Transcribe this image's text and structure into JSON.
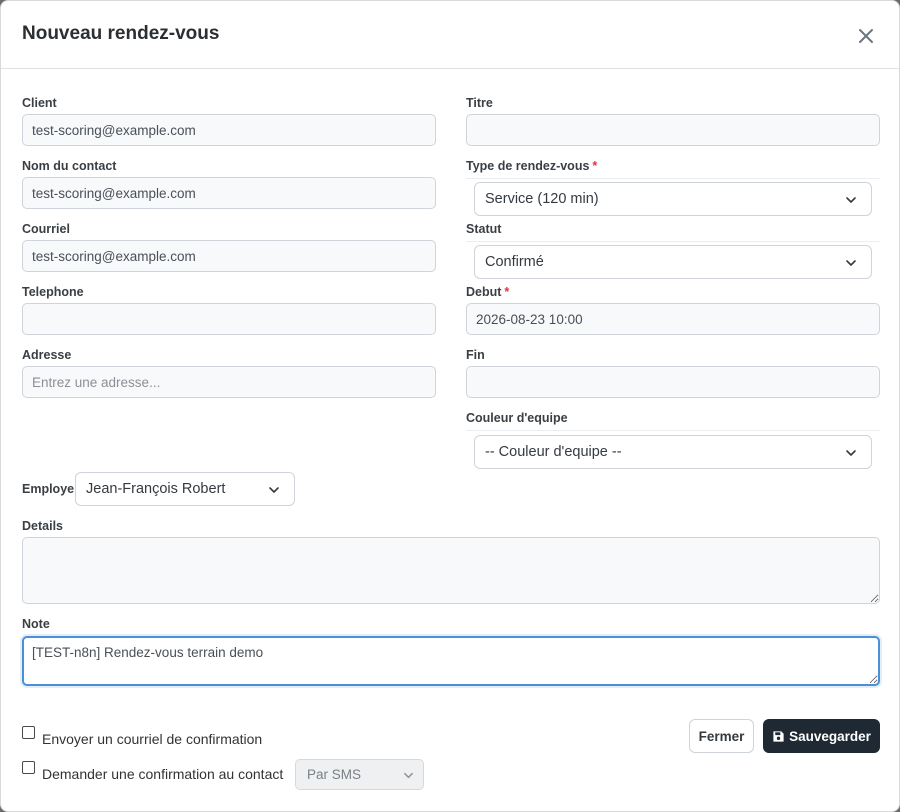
{
  "modal": {
    "title": "Nouveau rendez-vous",
    "close_icon": "close-icon"
  },
  "form": {
    "client": {
      "label": "Client",
      "value": "test-scoring@example.com"
    },
    "contact_name": {
      "label": "Nom du contact",
      "value": "test-scoring@example.com"
    },
    "email": {
      "label": "Courriel",
      "value": "test-scoring@example.com"
    },
    "phone": {
      "label": "Telephone",
      "value": ""
    },
    "address": {
      "label": "Adresse",
      "value": "",
      "placeholder": "Entrez une adresse..."
    },
    "title": {
      "label": "Titre",
      "value": ""
    },
    "appointment_type": {
      "label": "Type de rendez-vous",
      "required_mark": "*",
      "selected": "Service (120 min)"
    },
    "status": {
      "label": "Statut",
      "selected": "Confirmé"
    },
    "start": {
      "label": "Debut",
      "required_mark": "*",
      "value": "2026-08-23 10:00"
    },
    "end": {
      "label": "Fin",
      "value": ""
    },
    "team_color": {
      "label": "Couleur d'equipe",
      "selected": "-- Couleur d'equipe --"
    },
    "employee": {
      "label": "Employe",
      "selected": "Jean-François Robert"
    },
    "details": {
      "label": "Details",
      "value": ""
    },
    "note": {
      "label": "Note",
      "value": "[TEST-n8n] Rendez-vous terrain demo"
    }
  },
  "options": {
    "send_confirmation": {
      "label": "Envoyer un courriel de confirmation",
      "checked": false
    },
    "request_confirmation": {
      "label": "Demander une confirmation au contact",
      "checked": false
    },
    "channel": {
      "selected": "Par SMS",
      "disabled": true
    }
  },
  "actions": {
    "close_label": "Fermer",
    "save_label": "Sauvegarder",
    "save_icon": "floppy-disk-icon"
  },
  "colors": {
    "primary_dark": "#1f2933",
    "required": "#dc3545",
    "focus_border": "#4a90d9"
  }
}
